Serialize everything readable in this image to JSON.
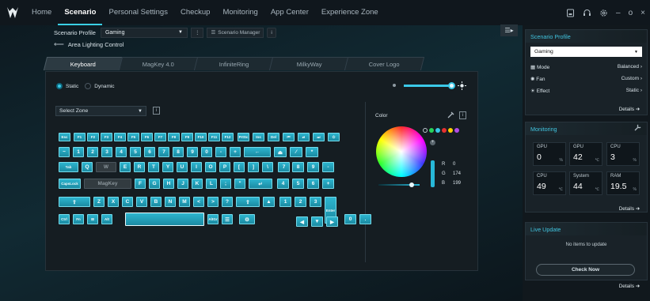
{
  "nav": {
    "tabs": [
      "Home",
      "Scenario",
      "Personal Settings",
      "Checkup",
      "Monitoring",
      "App Center",
      "Experience Zone"
    ]
  },
  "winctl": {
    "minimize": "–",
    "maximize": "o",
    "close": "×"
  },
  "profile": {
    "label": "Scenario Profile",
    "value": "Gaming",
    "manager": "Scenario Manager"
  },
  "back": {
    "label": "Area Lighting Control"
  },
  "tabs": [
    "Keyboard",
    "MagKey 4.0",
    "InfiniteRing",
    "MilkyWay",
    "Cover Logo"
  ],
  "modes": {
    "static": "Static",
    "dynamic": "Dynamic"
  },
  "zone": {
    "placeholder": "Select Zone"
  },
  "color": {
    "title": "Color",
    "r_label": "R",
    "r": "0",
    "g_label": "G",
    "g": "174",
    "b_label": "B",
    "b": "199",
    "swatches": [
      "#ffffff",
      "#27d35a",
      "#38c9e6",
      "#e63030",
      "#ffd000",
      "#b04ce6"
    ]
  },
  "keys": {
    "r1": [
      "Esc",
      "F1",
      "F2",
      "F3",
      "F4",
      "F5",
      "F6",
      "F7",
      "F8",
      "F9",
      "F10",
      "F11",
      "F12",
      "PrtSc",
      "Ins",
      "Del",
      "⏮",
      "⏯",
      "⏭",
      "⏻"
    ],
    "r2": [
      "~",
      "1",
      "2",
      "3",
      "4",
      "5",
      "6",
      "7",
      "8",
      "9",
      "0",
      "-",
      "+",
      "←",
      "⏏",
      "⁄",
      "*"
    ],
    "r3": [
      "Tab",
      "Q",
      "W",
      "E",
      "R",
      "T",
      "Y",
      "U",
      "I",
      "O",
      "P",
      "[",
      "]",
      "\\",
      "7",
      "8",
      "9",
      "-"
    ],
    "r4": [
      "CapsLock",
      "MagKey",
      "F",
      "G",
      "H",
      "J",
      "K",
      "L",
      ";",
      "\"",
      "↵",
      "4",
      "5",
      "6",
      "+"
    ],
    "r5": [
      "⇧",
      "Z",
      "X",
      "C",
      "V",
      "B",
      "N",
      "M",
      "<",
      ">",
      "?",
      "⇧",
      "▲",
      "1",
      "2",
      "3",
      "Enter"
    ],
    "r6": [
      "Ctrl",
      "Fn",
      "⊞",
      "Alt",
      "AltGr",
      "☰",
      "⚙",
      "◀",
      "▼",
      "▶",
      "0",
      "."
    ]
  },
  "sidebar": {
    "profile_title": "Scenario Profile",
    "profile_value": "Gaming",
    "mode_label": "Mode",
    "mode_value": "Balanced",
    "fan_label": "Fan",
    "fan_value": "Custom",
    "effect_label": "Effect",
    "effect_value": "Static",
    "details": "Details",
    "monitoring_title": "Monitoring",
    "mon": [
      {
        "l": "GPU",
        "v": "0",
        "u": "%"
      },
      {
        "l": "GPU",
        "v": "42",
        "u": "℃"
      },
      {
        "l": "CPU",
        "v": "3",
        "u": "%"
      },
      {
        "l": "CPU",
        "v": "49",
        "u": "℃"
      },
      {
        "l": "System",
        "v": "44",
        "u": "℃"
      },
      {
        "l": "RAM",
        "v": "19.5",
        "u": "%"
      }
    ],
    "live_title": "Live Update",
    "live_empty": "No items to update",
    "check": "Check Now"
  }
}
